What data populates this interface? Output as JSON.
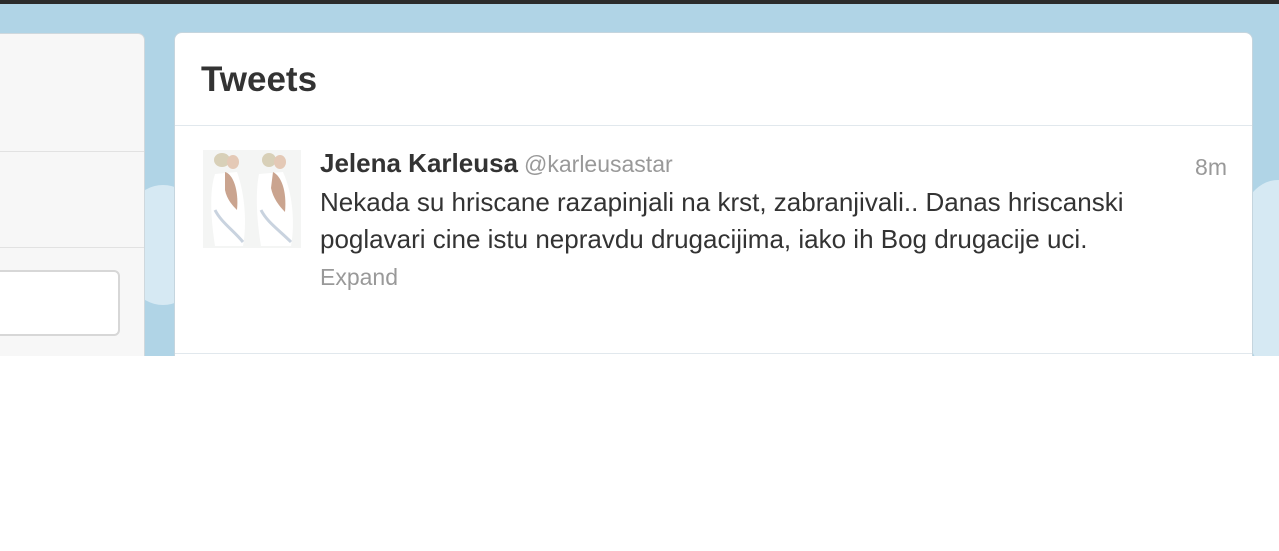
{
  "timeline": {
    "title": "Tweets"
  },
  "tweets": [
    {
      "fullname": "Jelena Karleusa",
      "username": "@karleusastar",
      "timestamp": "8m",
      "text": "Nekada su hriscane razapinjali na krst, zabranjivali.. Danas hriscanski poglavari cine istu nepravdu drugacijima, iako ih Bog drugacije uci.",
      "expand_label": "Expand",
      "avatar_icon": "avatar-photo"
    }
  ],
  "colors": {
    "background": "#b0d4e6",
    "name": "#333333",
    "muted": "#999999"
  }
}
